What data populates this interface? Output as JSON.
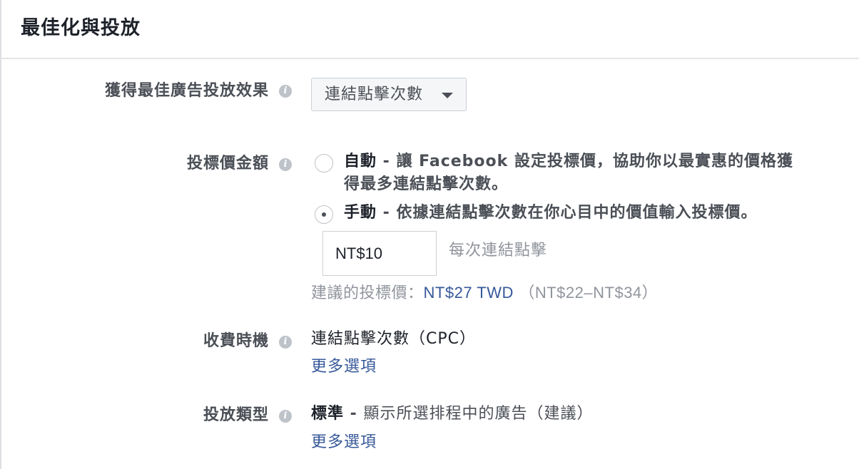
{
  "header": {
    "title": "最佳化與投放"
  },
  "optimization": {
    "label": "獲得最佳廣告投放效果",
    "info_icon": "info-icon",
    "selected": "連結點擊次數"
  },
  "bid": {
    "label": "投標價金額",
    "auto": {
      "title": "自動",
      "separator": " - ",
      "description_line1": "讓 Facebook 設定投標價，協助你以最實惠的價格獲",
      "description_line2": "得最多連結點擊次數。",
      "checked": false
    },
    "manual": {
      "title": "手動",
      "separator": " - ",
      "description": "依據連結點擊次數在你心目中的價值輸入投標價。",
      "checked": true
    },
    "input_value": "NT$10",
    "unit_label": "每次連結點擊",
    "suggested_prefix": "建議的投標價：",
    "suggested_value": "NT$27 TWD",
    "suggested_range": "（NT$22–NT$34）"
  },
  "charge": {
    "label": "收費時機",
    "value": "連結點擊次數（CPC）",
    "more_link": "更多選項"
  },
  "delivery": {
    "label": "投放類型",
    "value_strong": "標準",
    "separator": " - ",
    "value_desc": "顯示所選排程中的廣告（建議）",
    "more_link": "更多選項"
  }
}
